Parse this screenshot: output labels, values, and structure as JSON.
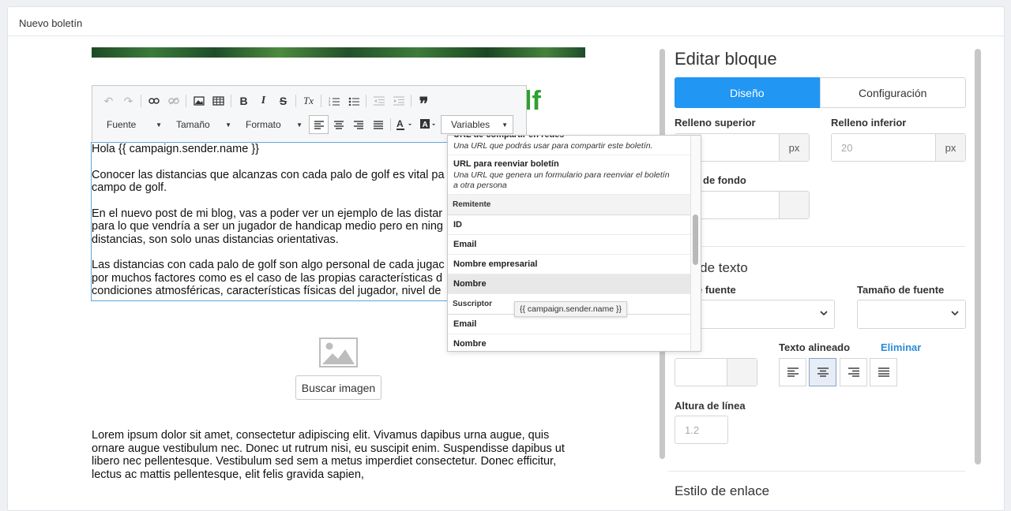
{
  "card": {
    "title": "Nuevo boletín"
  },
  "toolbar": {
    "font_label": "Fuente",
    "size_label": "Tamaño",
    "format_label": "Formato",
    "variables_label": "Variables",
    "bold": "B",
    "italic": "I",
    "strike": "S",
    "clear_format": "Tx",
    "quote": "❞"
  },
  "email": {
    "heading_fragment": "lf",
    "paragraphs": [
      [
        "Hola {{ campaign.sender.name }}"
      ],
      [
        "Conocer las distancias que alcanzas con cada palo de golf es vital pa",
        "campo de golf."
      ],
      [
        "En el nuevo post de mi blog, vas a poder ver un ejemplo de las distar",
        "para lo que vendría a ser un jugador de handicap medio pero en ning",
        "distancias, son solo unas distancias orientativas."
      ],
      [
        "Las distancias con cada palo de golf son algo personal de cada jugac",
        "por muchos factores como es el caso de las propias características d",
        "condiciones atmosféricas, características físicas del jugador, nivel de"
      ]
    ],
    "find_image_button": "Buscar imagen",
    "lorem_lines": [
      "Lorem ipsum dolor sit amet, consectetur adipiscing elit. Vivamus dapibus urna augue, quis",
      "ornare augue vestibulum nec. Donec ut rutrum nisi, eu suscipit enim. Suspendisse dapibus ut",
      "libero nec pellentesque. Vestibulum sed sem a metus imperdiet consectetur. Donec efficitur,",
      "lectus ac mattis pellentesque, elit felis gravida sapien,"
    ]
  },
  "variables_menu": {
    "items": [
      {
        "title": "URL de compartir en redes",
        "desc": [
          "Una URL que podrás usar para compartir este boletín."
        ]
      },
      {
        "title": "URL para reenviar boletín",
        "desc": [
          "Una URL que genera un formulario para reenviar el boletín",
          "a otra persona"
        ]
      }
    ],
    "group_sender": "Remitente",
    "sender_items": [
      "ID",
      "Email",
      "Nombre empresarial",
      "Nombre"
    ],
    "group_subscriber": "Suscriptor",
    "subscriber_items": [
      "Email",
      "Nombre"
    ],
    "tooltip": "{{ campaign.sender.name }}"
  },
  "panel": {
    "title": "Editar bloque",
    "tab_design": "Diseño",
    "tab_config": "Configuración",
    "padding_top_label": "Relleno superior",
    "padding_bottom_label": "Relleno inferior",
    "padding_top_value": "",
    "padding_bottom_value": "20",
    "unit": "px",
    "bg_label": "de fondo",
    "text_style_title": "o de texto",
    "font_label": "de fuente",
    "font_size_label": "Tamaño de fuente",
    "align_label": "Texto alineado",
    "remove_link": "Eliminar",
    "line_height_label": "Altura de línea",
    "line_height_value": "1.2",
    "link_style_title": "Estilo de enlace"
  },
  "colors": {
    "accent": "#2196f3",
    "link": "#2a8cd6",
    "brand_green": "#2ea12f"
  }
}
